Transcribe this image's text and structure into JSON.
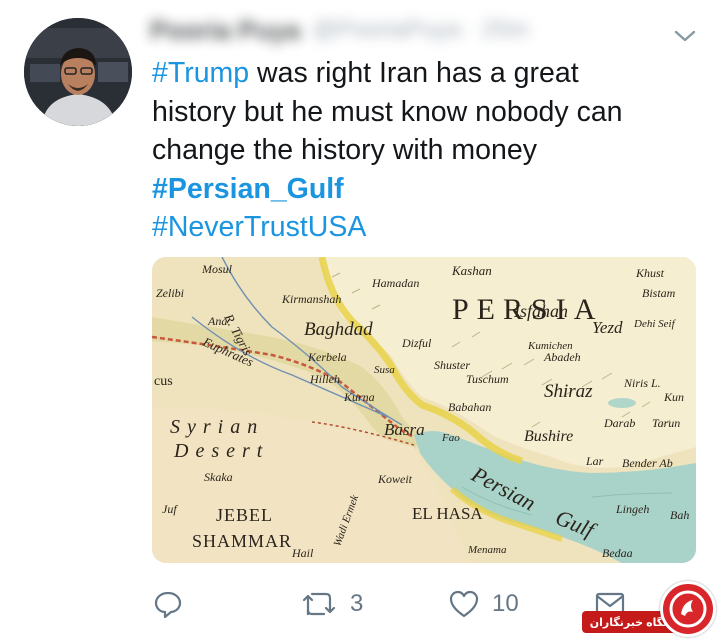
{
  "tweet": {
    "author_name": "Pooria Puya",
    "author_handle": "@PooriaPuya · 25m",
    "lines": [
      "#Trump was right  Iran has a great",
      "history but he must know nobody can",
      "change the history with money"
    ],
    "hashtag_trump": "#Trump",
    "line1_rest": " was right  Iran has a great",
    "hashtag_gulf": "#Persian_Gulf",
    "hashtag_never": "#NeverTrustUSA"
  },
  "map": {
    "persia": "PERSIA",
    "isfahan": "Isfahan",
    "yezd": "Yezd",
    "baghdad": "Baghdad",
    "basra": "Basra",
    "shiraz": "Shiraz",
    "bushire": "Bushire",
    "persian_gulf_1": "Persian",
    "persian_gulf_2": "Gulf",
    "syrian": "Syrian",
    "desert": "Desert",
    "jebel": "JEBEL",
    "shammar": "SHAMMAR",
    "el_hasa": "EL HASA",
    "kashan": "Kashan",
    "kermanshah": "Kirmanshah",
    "hamadan": "Hamadan",
    "tigris": "R. Tigris",
    "euphrates": "Euphrates",
    "mosul": "Mosul",
    "dizful": "Dizful",
    "shuster": "Shuster",
    "abadeh": "Abadeh",
    "kumichen": "Kumichen",
    "kuweit": "Koweit",
    "hail": "Hail",
    "wadi": "Wadi Ermek",
    "bistam": "Bistam",
    "khust": "Khust",
    "dehiseif": "Dehi Seif",
    "niris": "Niris L.",
    "darab": "Darab",
    "lar": "Lar",
    "bender": "Bender Ab",
    "lingeh": "Lingeh",
    "bedaa": "Bedaa",
    "tarun": "Tarun",
    "kun": "Kun",
    "hilleh": "Hilleh",
    "kerbela": "Kerbela",
    "skaka": "Skaka",
    "jof": "Juf",
    "ana": "Ana",
    "menama": "Menama",
    "fao": "Fao",
    "babahan": "Babahan",
    "tusehum": "Tuschum",
    "usa": "Susa",
    "kurna": "Kurna",
    "cus": "cus",
    "zelibi": "Zelibi",
    "bahrein": "Bah"
  },
  "actions": {
    "reply_icon": "reply-icon",
    "retweet_icon": "retweet-icon",
    "retweet_count": "3",
    "like_icon": "heart-icon",
    "like_count": "10",
    "dm_icon": "envelope-icon"
  },
  "watermark": {
    "text": "باشگاه خبرنگاران"
  },
  "colors": {
    "hashtag": "#1b95e0",
    "muted": "#657786",
    "text": "#14171a",
    "sea": "#a9d3c9",
    "land": "#efe3bd",
    "persia_land": "#f5eccb",
    "border_yellow": "#e9d24a",
    "border_red": "#c9573e",
    "watermark_red": "#c41a1a"
  }
}
